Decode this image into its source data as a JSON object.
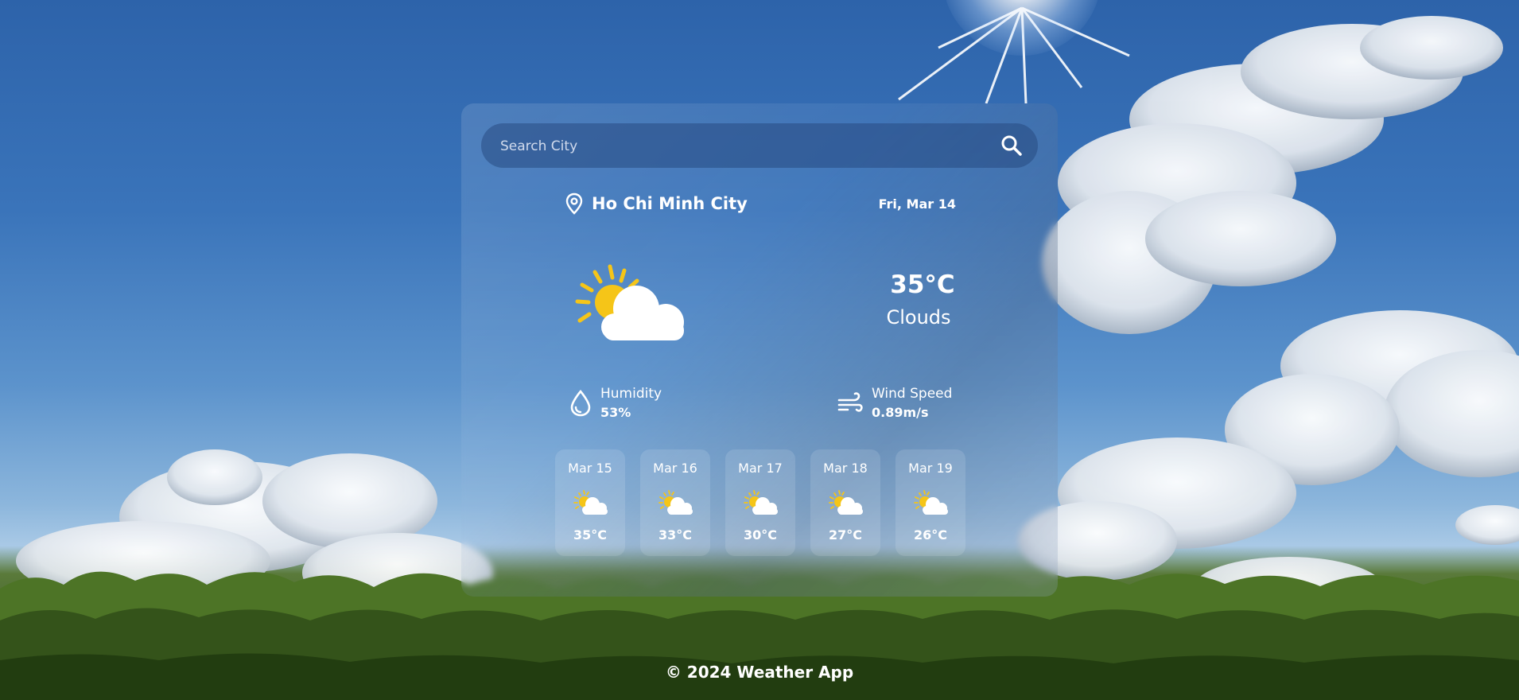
{
  "search": {
    "placeholder": "Search City",
    "icon": "search-icon"
  },
  "location": {
    "icon": "map-pin-icon",
    "city": "Ho Chi Minh City",
    "date": "Fri, Mar 14"
  },
  "current": {
    "icon": "partly-cloudy-icon",
    "temperature": "35°C",
    "condition": "Clouds"
  },
  "stats": {
    "humidity": {
      "icon": "droplet-icon",
      "label": "Humidity",
      "value": "53%"
    },
    "wind": {
      "icon": "wind-icon",
      "label": "Wind Speed",
      "value": "0.89m/s"
    }
  },
  "forecast": [
    {
      "date": "Mar 15",
      "icon": "partly-cloudy-icon",
      "temp": "35°C"
    },
    {
      "date": "Mar 16",
      "icon": "partly-cloudy-icon",
      "temp": "33°C"
    },
    {
      "date": "Mar 17",
      "icon": "partly-cloudy-icon",
      "temp": "30°C"
    },
    {
      "date": "Mar 18",
      "icon": "partly-cloudy-icon",
      "temp": "27°C"
    },
    {
      "date": "Mar 19",
      "icon": "partly-cloudy-icon",
      "temp": "26°C"
    }
  ],
  "footer": {
    "text": "© 2024 Weather App"
  },
  "colors": {
    "sun": "#f5c518",
    "cloud": "#ffffff",
    "text": "#ffffff",
    "sky": "#2d63aa"
  }
}
